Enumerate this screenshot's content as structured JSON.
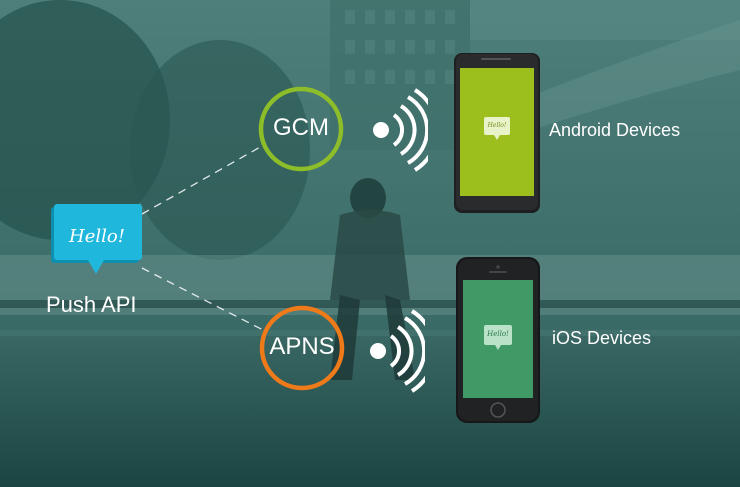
{
  "push_api": {
    "bubble_text": "Hello!",
    "label": "Push API"
  },
  "services": [
    {
      "name": "GCM",
      "color": "#8dbe2a"
    },
    {
      "name": "APNS",
      "color": "#ef7a1a"
    }
  ],
  "devices": [
    {
      "label": "Android Devices",
      "screen_color": "#9cbf1e",
      "bubble_text": "Hello!"
    },
    {
      "label": "iOS Devices",
      "screen_color": "#3f9a66",
      "bubble_text": "Hello!"
    }
  ],
  "colors": {
    "bubble": "#1fb8dc",
    "text": "#ffffff"
  }
}
